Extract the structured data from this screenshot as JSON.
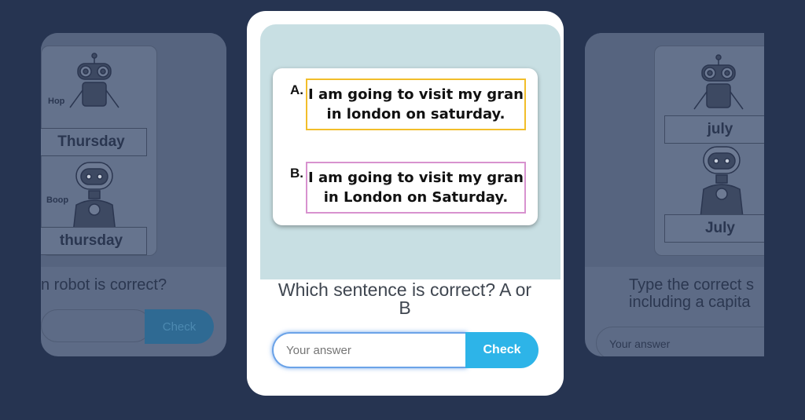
{
  "left_card": {
    "robots": [
      {
        "name": "Hop",
        "word": "Thursday"
      },
      {
        "name": "Boop",
        "word": "thursday"
      }
    ],
    "question": "n robot is correct?",
    "check_label": "Check"
  },
  "main_card": {
    "options": [
      {
        "letter": "A.",
        "text": "I am going to visit my gran in london on saturday."
      },
      {
        "letter": "B.",
        "text": "I am going to visit my gran in London on Saturday."
      }
    ],
    "question": "Which sentence is correct? A or B",
    "input_placeholder": "Your answer",
    "check_label": "Check"
  },
  "right_card": {
    "robots": [
      {
        "word": "july"
      },
      {
        "word": "July"
      }
    ],
    "question_line1": "Type the correct s",
    "question_line2": "including a capita",
    "input_placeholder": "Your answer"
  }
}
